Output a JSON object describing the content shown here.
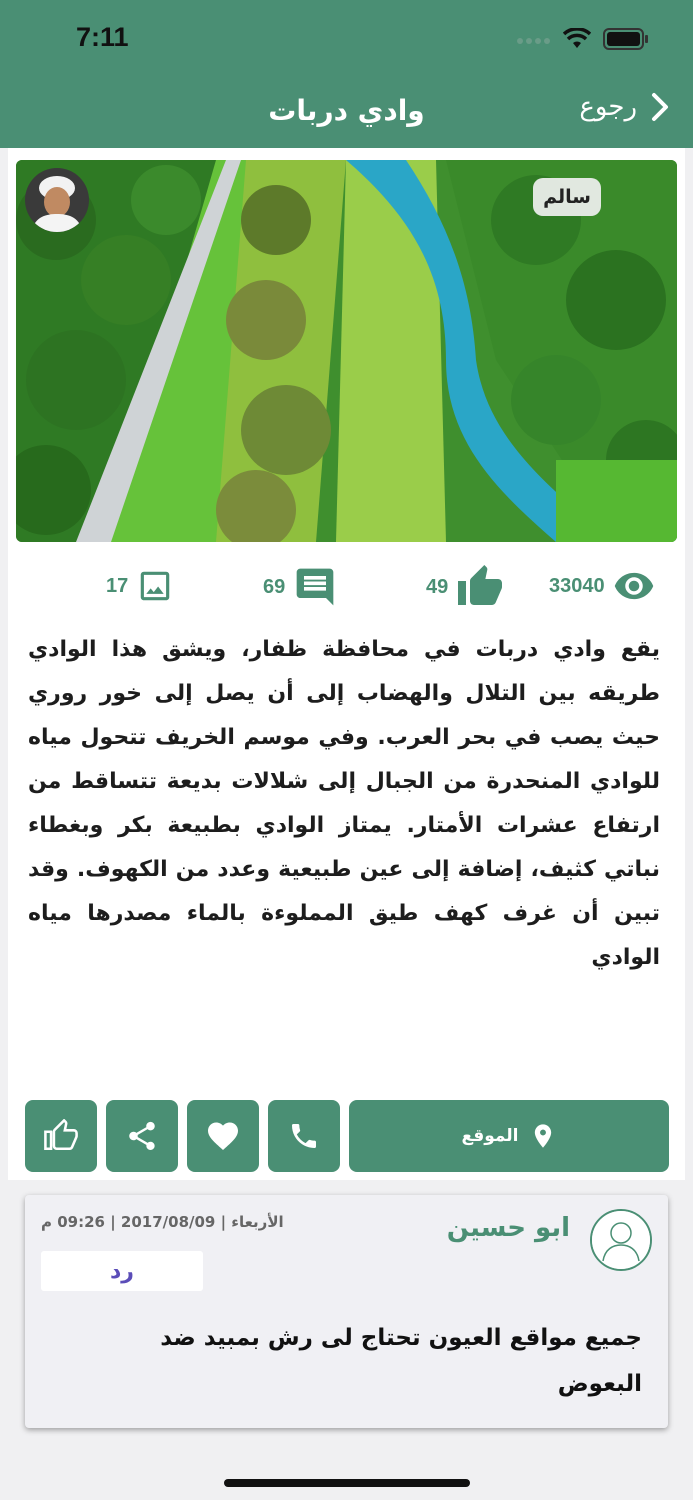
{
  "status_bar": {
    "time": "7:11"
  },
  "nav": {
    "title": "وادي دربات",
    "back_label": "رجوع"
  },
  "post": {
    "author_name": "سالم",
    "stats": {
      "views": "33040",
      "likes": "49",
      "comments": "69",
      "photos": "17"
    },
    "description": "يقع وادي دربات في محافظة ظفار، ويشق هذا الوادي طريقه بين التلال والهضاب إلى أن يصل إلى خور روري حيث يصب في بحر العرب. وفي موسم الخريف تتحول مياه للوادي المنحدرة من الجبال إلى شلالات بديعة تتساقط من ارتفاع عشرات الأمتار. يمتاز الوادي بطبيعة بكر وبغطاء نباتي كثيف، إضافة إلى عين طبيعية وعدد من الكهوف. وقد تبين أن غرف كهف طيق المملوءة بالماء مصدرها مياه الوادي",
    "actions": {
      "location_label": "الموقع"
    }
  },
  "comment": {
    "author": "ابو حسين",
    "date": "الأربعاء | 2017/08/09 | 09:26 م",
    "reply_label": "رد",
    "text": "جميع مواقع العيون تحتاج لى رش بمبيد ضد البعوض"
  },
  "colors": {
    "primary": "#4a8f74",
    "reply": "#5b4db8"
  }
}
